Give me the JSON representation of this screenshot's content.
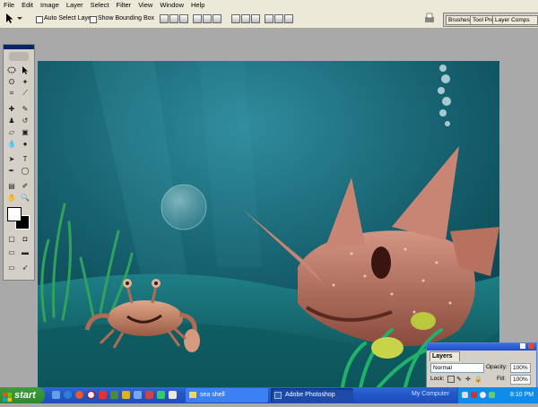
{
  "menubar": {
    "items": [
      "File",
      "Edit",
      "Image",
      "Layer",
      "Select",
      "Filter",
      "View",
      "Window",
      "Help"
    ]
  },
  "options_bar": {
    "auto_select_label": "Auto Select Layer",
    "show_bounding_label": "Show Bounding Box",
    "auto_select_checked": false,
    "show_bounding_checked": false
  },
  "palette_well": {
    "tabs": [
      "Brushes",
      "Tool Pre",
      "Layer Comps"
    ]
  },
  "layers_palette": {
    "tab_label": "Layers",
    "blend_mode": "Normal",
    "opacity_label": "Opacity:",
    "opacity_value": "100%",
    "lock_label": "Lock:",
    "fill_label": "Fill:",
    "fill_value": "100%"
  },
  "taskbar": {
    "start_label": "start",
    "tasks": [
      "sea shell",
      "Adobe Photoshop"
    ],
    "active_task": "Adobe Photoshop",
    "tray_label": "My Computer",
    "clock": "8:10 PM"
  },
  "colors": {
    "menubar_bg": "#ece9d8",
    "workspace_bg": "#a9a9a9",
    "taskbar_blue": "#2457c8",
    "start_green": "#2d8a2d",
    "palette_title_blue": "#1f4fc8"
  },
  "icons": [
    "move-tool-icon",
    "marquee-tool-icon",
    "lasso-tool-icon",
    "magic-wand-icon",
    "crop-tool-icon",
    "brush-tool-icon",
    "eraser-tool-icon",
    "type-tool-icon",
    "pen-tool-icon",
    "hand-tool-icon",
    "zoom-tool-icon",
    "print-icon",
    "windows-logo-icon"
  ]
}
